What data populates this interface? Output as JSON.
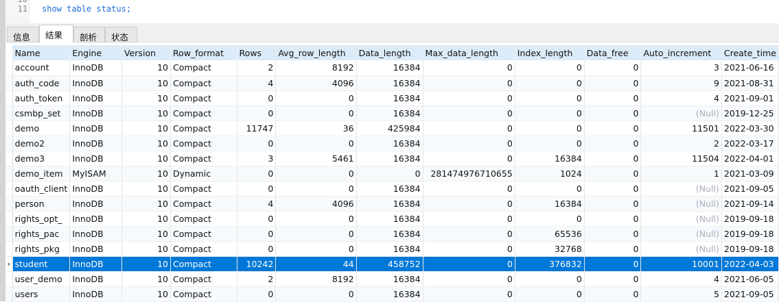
{
  "editor": {
    "lines": [
      {
        "no": "10",
        "text": ""
      },
      {
        "no": "11",
        "text": "show table status;"
      }
    ]
  },
  "tabs": [
    "信息",
    "结果 1",
    "剖析",
    "状态"
  ],
  "active_tab": 1,
  "columns": [
    "Name",
    "Engine",
    "Version",
    "Row_format",
    "Rows",
    "Avg_row_length",
    "Data_length",
    "Max_data_length",
    "Index_length",
    "Data_free",
    "Auto_increment",
    "Create_time"
  ],
  "null_text": "(Null)",
  "selected_row": 13,
  "rows": [
    [
      "account",
      "InnoDB",
      "10",
      "Compact",
      "2",
      "8192",
      "16384",
      "0",
      "0",
      "0",
      "3",
      "2021-06-16"
    ],
    [
      "auth_code",
      "InnoDB",
      "10",
      "Compact",
      "4",
      "4096",
      "16384",
      "0",
      "0",
      "0",
      "9",
      "2021-08-31"
    ],
    [
      "auth_token",
      "InnoDB",
      "10",
      "Compact",
      "0",
      "0",
      "16384",
      "0",
      "0",
      "0",
      "4",
      "2021-09-01"
    ],
    [
      "csmbp_set",
      "InnoDB",
      "10",
      "Compact",
      "0",
      "0",
      "16384",
      "0",
      "0",
      "0",
      null,
      "2019-12-25"
    ],
    [
      "demo",
      "InnoDB",
      "10",
      "Compact",
      "11747",
      "36",
      "425984",
      "0",
      "0",
      "0",
      "11501",
      "2022-03-30"
    ],
    [
      "demo2",
      "InnoDB",
      "10",
      "Compact",
      "0",
      "0",
      "16384",
      "0",
      "0",
      "0",
      "2",
      "2022-03-17"
    ],
    [
      "demo3",
      "InnoDB",
      "10",
      "Compact",
      "3",
      "5461",
      "16384",
      "0",
      "16384",
      "0",
      "11504",
      "2022-04-01"
    ],
    [
      "demo_item",
      "MyISAM",
      "10",
      "Dynamic",
      "0",
      "0",
      "0",
      "281474976710655",
      "1024",
      "0",
      "1",
      "2021-03-09"
    ],
    [
      "oauth_client",
      "InnoDB",
      "10",
      "Compact",
      "0",
      "0",
      "16384",
      "0",
      "0",
      "0",
      null,
      "2021-09-05"
    ],
    [
      "person",
      "InnoDB",
      "10",
      "Compact",
      "4",
      "4096",
      "16384",
      "0",
      "16384",
      "0",
      null,
      "2021-09-14"
    ],
    [
      "rights_opt_",
      "InnoDB",
      "10",
      "Compact",
      "0",
      "0",
      "16384",
      "0",
      "0",
      "0",
      null,
      "2019-09-18"
    ],
    [
      "rights_pac",
      "InnoDB",
      "10",
      "Compact",
      "0",
      "0",
      "16384",
      "0",
      "65536",
      "0",
      null,
      "2019-09-18"
    ],
    [
      "rights_pkg",
      "InnoDB",
      "10",
      "Compact",
      "0",
      "0",
      "16384",
      "0",
      "32768",
      "0",
      null,
      "2019-09-18"
    ],
    [
      "student",
      "InnoDB",
      "10",
      "Compact",
      "10242",
      "44",
      "458752",
      "0",
      "376832",
      "0",
      "10001",
      "2022-04-03"
    ],
    [
      "user_demo",
      "InnoDB",
      "10",
      "Compact",
      "2",
      "8192",
      "16384",
      "0",
      "0",
      "0",
      "4",
      "2021-06-05"
    ],
    [
      "users",
      "InnoDB",
      "10",
      "Compact",
      "0",
      "0",
      "16384",
      "0",
      "0",
      "0",
      "5",
      "2021-09-05"
    ]
  ]
}
